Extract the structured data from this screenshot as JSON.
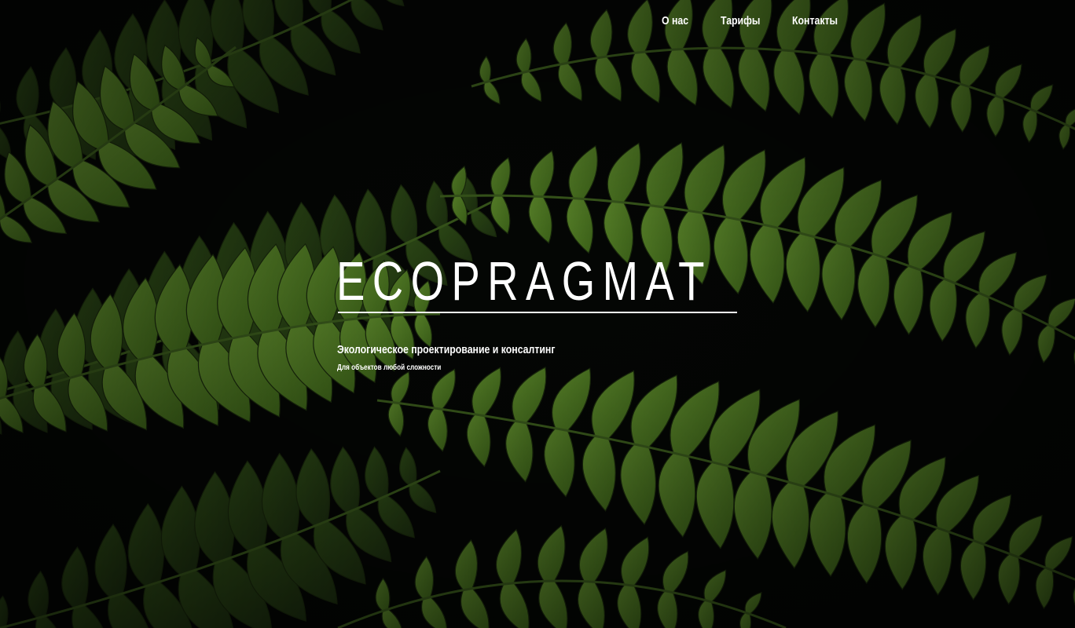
{
  "nav": {
    "items": [
      {
        "label": "О нас"
      },
      {
        "label": "Тарифы"
      },
      {
        "label": "Контакты"
      }
    ]
  },
  "hero": {
    "title": "ECOPRAGMAT",
    "tagline": "Экологическое проектирование и консалтинг",
    "subtagline": "Для объектов любой сложности",
    "background": "fern-leaves-photo"
  },
  "colors": {
    "background": "#050805",
    "leaf": "#4f7a25",
    "leaf_dark": "#2c4a16",
    "text": "#ffffff"
  }
}
